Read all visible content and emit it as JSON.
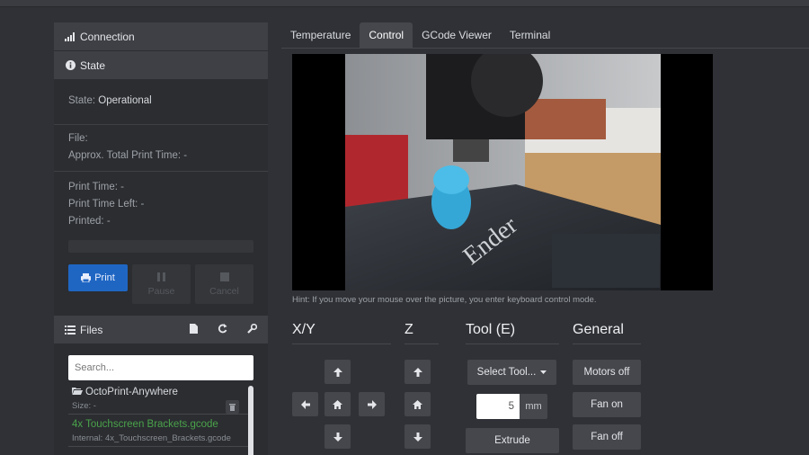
{
  "sidebar": {
    "connection_title": "Connection",
    "state_title": "State",
    "state_label": "State",
    "state_value": "Operational",
    "file_label": "File:",
    "file_value": "",
    "approx_label": "Approx. Total Print Time:",
    "approx_value": "-",
    "print_time_label": "Print Time:",
    "print_time_value": "-",
    "print_left_label": "Print Time Left:",
    "print_left_value": "-",
    "printed_label": "Printed:",
    "printed_value": "-",
    "print_progress": 0,
    "buttons": {
      "print": "Print",
      "pause": "Pause",
      "cancel": "Cancel"
    },
    "files_title": "Files",
    "search_placeholder": "Search...",
    "files": [
      {
        "name": "OctoPrint-Anywhere",
        "meta": "Size: -"
      },
      {
        "name": "4x Touchscreen Brackets.gcode",
        "meta": "Internal: 4x_Touchscreen_Brackets.gcode"
      }
    ]
  },
  "tabs": [
    "Temperature",
    "Control",
    "GCode Viewer",
    "Terminal"
  ],
  "active_tab": "Control",
  "webcam_hint": "Hint: If you move your mouse over the picture, you enter keyboard control mode.",
  "control": {
    "xy_title": "X/Y",
    "z_title": "Z",
    "tool_title": "Tool (E)",
    "general_title": "General",
    "select_tool": "Select Tool...",
    "extrude_amount": "5",
    "extrude_unit": "mm",
    "extrude": "Extrude",
    "motors_off": "Motors off",
    "fan_on": "Fan on",
    "fan_off": "Fan off"
  },
  "colors": {
    "accent": "#1f66c3",
    "file_selected": "#4aa34a",
    "panel": "#2b2d31"
  }
}
